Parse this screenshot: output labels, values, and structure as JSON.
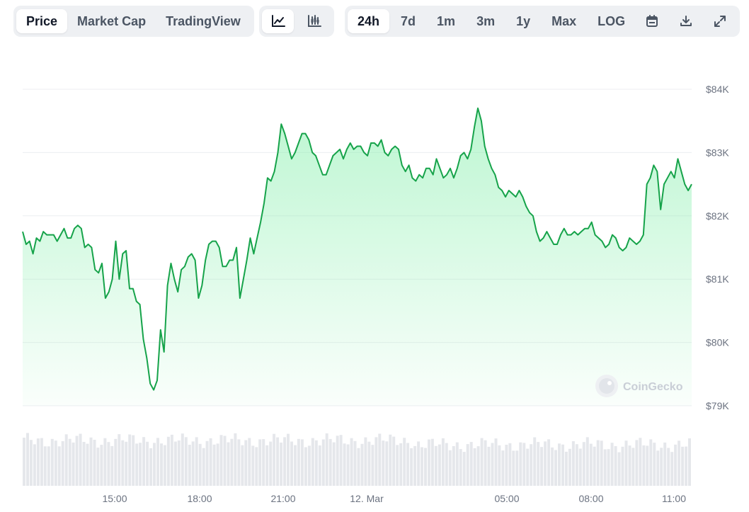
{
  "toolbar_type": {
    "items": [
      {
        "label": "Price",
        "active": true
      },
      {
        "label": "Market Cap",
        "active": false
      },
      {
        "label": "TradingView",
        "active": false
      }
    ]
  },
  "toolbar_view": {
    "items": [
      {
        "icon": "line-chart-icon",
        "active": true
      },
      {
        "icon": "candlestick-chart-icon",
        "active": false
      }
    ]
  },
  "toolbar_range": {
    "items": [
      {
        "label": "24h",
        "active": true
      },
      {
        "label": "7d",
        "active": false
      },
      {
        "label": "1m",
        "active": false
      },
      {
        "label": "3m",
        "active": false
      },
      {
        "label": "1y",
        "active": false
      },
      {
        "label": "Max",
        "active": false
      },
      {
        "label": "LOG",
        "active": false
      }
    ],
    "icons": [
      "calendar-icon",
      "download-icon",
      "expand-icon"
    ]
  },
  "watermark": "CoinGecko",
  "colors": {
    "line": "#16a34a",
    "fill_top": "#86efac",
    "grid": "#eceef1",
    "volume": "#e5e7eb"
  },
  "chart_data": {
    "type": "area",
    "title": "",
    "xlabel": "",
    "ylabel": "",
    "x_ticks": [
      "15:00",
      "18:00",
      "21:00",
      "12. Mar",
      "05:00",
      "08:00",
      "11:00"
    ],
    "y_ticks": [
      "$79K",
      "$80K",
      "$81K",
      "$82K",
      "$83K",
      "$84K"
    ],
    "ylim": [
      79000,
      84000
    ],
    "grid": true,
    "series": [
      {
        "values": [
          81750,
          81550,
          81600,
          81400,
          81650,
          81600,
          81750,
          81700,
          81700,
          81700,
          81600,
          81700,
          81800,
          81650,
          81650,
          81800,
          81850,
          81800,
          81500,
          81550,
          81500,
          81150,
          81100,
          81250,
          80700,
          80800,
          81000,
          81600,
          81000,
          81400,
          81450,
          80850,
          80850,
          80650,
          80600,
          80050,
          79750,
          79350,
          79250,
          79400,
          80200,
          79850,
          80900,
          81250,
          81000,
          80800,
          81150,
          81200,
          81350,
          81400,
          81300,
          80700,
          80900,
          81300,
          81550,
          81600,
          81600,
          81500,
          81200,
          81200,
          81300,
          81300,
          81500,
          80700,
          81000,
          81300,
          81650,
          81400,
          81650,
          81900,
          82200,
          82600,
          82550,
          82700,
          83000,
          83450,
          83300,
          83100,
          82900,
          83000,
          83150,
          83300,
          83300,
          83200,
          83000,
          82950,
          82800,
          82650,
          82650,
          82800,
          82950,
          83000,
          83050,
          82900,
          83050,
          83150,
          83050,
          83100,
          83100,
          83000,
          82950,
          83150,
          83150,
          83100,
          83200,
          83000,
          82950,
          83050,
          83100,
          83050,
          82800,
          82700,
          82800,
          82600,
          82550,
          82650,
          82600,
          82750,
          82750,
          82650,
          82900,
          82750,
          82600,
          82650,
          82750,
          82600,
          82750,
          82950,
          83000,
          82900,
          83050,
          83400,
          83700,
          83500,
          83100,
          82900,
          82750,
          82650,
          82450,
          82400,
          82300,
          82400,
          82350,
          82300,
          82400,
          82300,
          82150,
          82050,
          82000,
          81750,
          81600,
          81650,
          81750,
          81650,
          81550,
          81550,
          81700,
          81800,
          81700,
          81700,
          81750,
          81700,
          81750,
          81800,
          81800,
          81900,
          81700,
          81650,
          81600,
          81500,
          81550,
          81700,
          81650,
          81500,
          81450,
          81500,
          81650,
          81600,
          81550,
          81600,
          81700,
          82500,
          82600,
          82800,
          82700,
          82100,
          82500,
          82600,
          82700,
          82600,
          82900,
          82700,
          82500,
          82400,
          82500
        ]
      }
    ]
  }
}
